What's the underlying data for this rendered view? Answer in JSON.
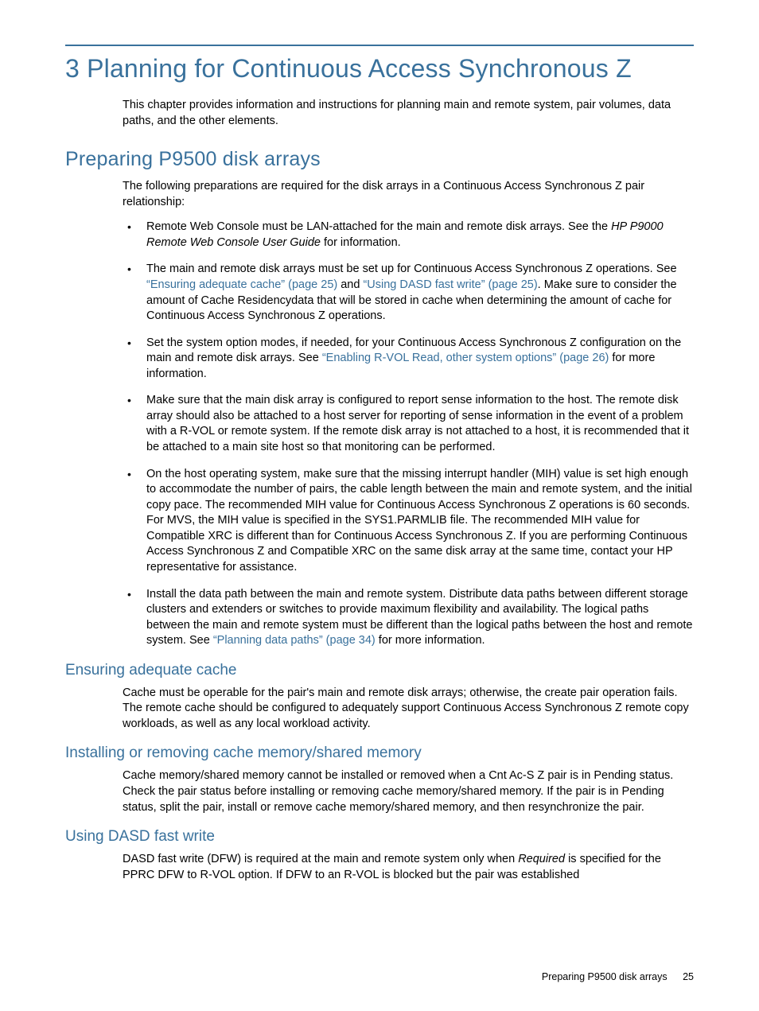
{
  "chapter": {
    "title": "3 Planning for Continuous Access Synchronous Z",
    "intro": "This chapter provides information and instructions for planning main and remote system, pair volumes, data paths, and the other elements."
  },
  "section1": {
    "heading": "Preparing P9500 disk arrays",
    "lead": "The following preparations are required for the disk arrays in a Continuous Access Synchronous Z pair relationship:",
    "b1a": "Remote Web Console must be LAN-attached for the main and remote disk arrays. See the ",
    "b1b": "HP P9000 Remote Web Console User Guide",
    "b1c": " for information.",
    "b2a": "The main and remote disk arrays must be set up for Continuous Access Synchronous Z operations. See ",
    "b2link1": "“Ensuring adequate cache” (page 25)",
    "b2mid": " and ",
    "b2link2": "“Using DASD fast write” (page 25)",
    "b2b": ". Make sure to consider the amount of Cache Residencydata that will be stored in cache when determining the amount of cache for Continuous Access Synchronous Z operations.",
    "b3a": "Set the system option modes, if needed, for your Continuous Access Synchronous Z configuration on the main and remote disk arrays. See ",
    "b3link": "“Enabling R-VOL Read, other system options” (page 26)",
    "b3b": " for more information.",
    "b4": "Make sure that the main disk array is configured to report sense information to the host. The remote disk array should also be attached to a host server for reporting of sense information in the event of a problem with a R-VOL or remote system. If the remote disk array is not attached to a host, it is recommended that it be attached to a main site host so that monitoring can be performed.",
    "b5": "On the host operating system, make sure that the missing interrupt handler (MIH) value is set high enough to accommodate the number of pairs, the cable length between the main and remote system, and the initial copy pace. The recommended MIH value for Continuous Access Synchronous Z operations is 60 seconds. For MVS, the MIH value is specified in the SYS1.PARMLIB file. The recommended MIH value for Compatible XRC is different than for Continuous Access Synchronous Z. If you are performing Continuous Access Synchronous Z and Compatible XRC on the same disk array at the same time, contact your HP representative for assistance.",
    "b6a": "Install the data path between the main and remote system. Distribute data paths between different storage clusters and extenders or switches to provide maximum flexibility and availability. The logical paths between the main and remote system must be different than the logical paths between the host and remote system. See ",
    "b6link": "“Planning data paths” (page 34)",
    "b6b": " for more information."
  },
  "sub1": {
    "heading": "Ensuring adequate cache",
    "para": "Cache must be operable for the pair's main and remote disk arrays; otherwise, the create pair operation fails. The remote cache should be configured to adequately support Continuous Access Synchronous Z remote copy workloads, as well as any local workload activity."
  },
  "sub2": {
    "heading": "Installing or removing cache memory/shared memory",
    "para": "Cache memory/shared memory cannot be installed or removed when a Cnt Ac-S Z pair is in Pending status. Check the pair status before installing or removing cache memory/shared memory. If the pair is in Pending status, split the pair, install or remove cache memory/shared memory, and then resynchronize the pair."
  },
  "sub3": {
    "heading": "Using DASD fast write",
    "p1a": "DASD fast write (DFW) is required at the main and remote system only when ",
    "p1b": "Required",
    "p1c": " is specified for the PPRC DFW to R-VOL option. If DFW to an R-VOL is blocked but the pair was established"
  },
  "footer": {
    "section": "Preparing P9500 disk arrays",
    "page": "25"
  }
}
